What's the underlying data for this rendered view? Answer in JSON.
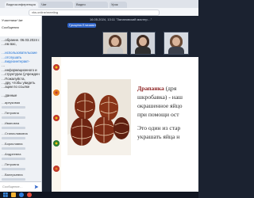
{
  "browser": {
    "tabs": [
      "Видеоконференция",
      "Чат",
      "Видео",
      "Урок"
    ],
    "address": "vks.online/meeting"
  },
  "chat": {
    "header_lines": [
      "Участники  Чат",
      "Сообщения"
    ],
    "intro_lines": [
      "…обрание. 06.03.2024 г.",
      "…ем вас,",
      "",
      "…использовательские",
      "…отслушать",
      "…видеоинтеракт-",
      "…",
      "…информационного и",
      "…структурах (учрежден",
      "…Пожалуйста,",
      "…дру, чтобы увидеть",
      "…ации по ссылке",
      "",
      "…данные"
    ],
    "entries": [
      {
        "who": "…ареуковая"
      },
      {
        "who": "…Петровна"
      },
      {
        "who": "…Ивановна"
      },
      {
        "who": "…Станиславовна"
      },
      {
        "who": "…Бориславна"
      },
      {
        "who": "…Андреевна"
      },
      {
        "who": "…Петровна"
      },
      {
        "who": "…Валерьевна"
      }
    ],
    "input_placeholder": "Сообщение…"
  },
  "meeting": {
    "title": "16.05.2024, 13:11  \"Залановский мастер…\"",
    "speaker_chip": "Грыцева Елизавет",
    "cameras": [
      "участник 1",
      "участник 2",
      "участник 3"
    ]
  },
  "slide": {
    "title_word": "Драпанка",
    "text_lines": [
      "(дря",
      "шкробавка) - наш",
      "окрашенное яйцо",
      "при помощи ост"
    ],
    "text_lines2": [
      "Это один из стар",
      "украшать яйца н"
    ]
  },
  "colors": {
    "accent": "#2e63c8",
    "slide_title": "#8b1e1e"
  }
}
